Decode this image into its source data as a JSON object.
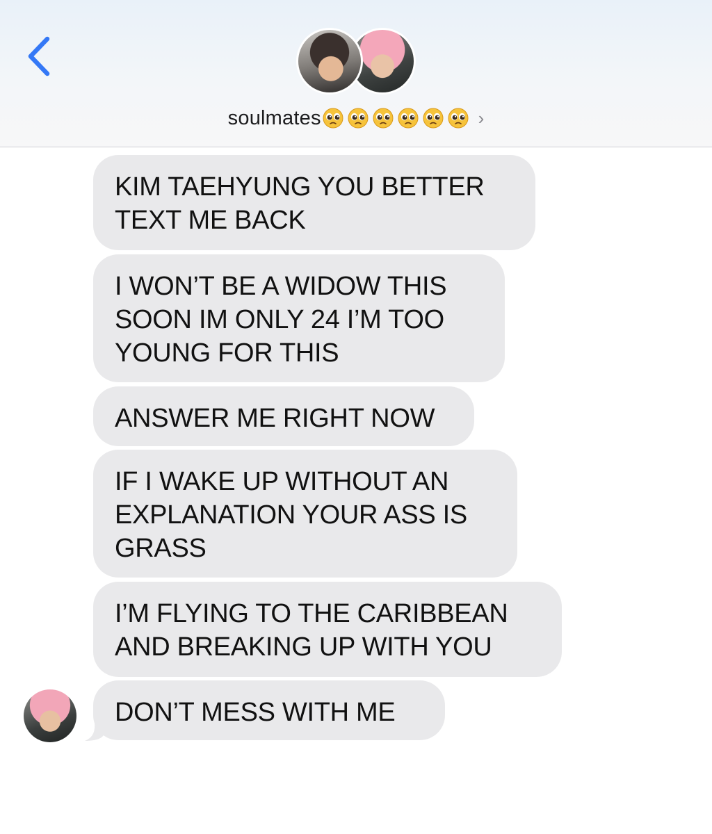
{
  "header": {
    "back_icon": "chevron-left-icon",
    "contact_name": "soulmates",
    "emoji_icon": "pleading-face-emoji",
    "emoji_count": 6,
    "disclosure_icon": "chevron-right-icon",
    "disclosure_glyph": "›",
    "accent_color": "#3478f6"
  },
  "messages": [
    {
      "lines": [
        "KIM TAEHYUNG YOU BETTER",
        "TEXT ME BACK"
      ]
    },
    {
      "lines": [
        "I WON’T BE A WIDOW THIS",
        "SOON IM ONLY 24 I’M TOO",
        "YOUNG FOR THIS"
      ]
    },
    {
      "lines": [
        "ANSWER ME RIGHT NOW"
      ]
    },
    {
      "lines": [
        "IF I WAKE UP WITHOUT AN",
        "EXPLANATION YOUR ASS IS",
        "GRASS"
      ]
    },
    {
      "lines": [
        "I’M FLYING TO THE CARIBBEAN",
        "AND BREAKING UP WITH YOU"
      ]
    },
    {
      "lines": [
        "DON’T MESS WITH ME"
      ]
    }
  ],
  "colors": {
    "bubble_received": "#e9e9eb",
    "text": "#111111"
  }
}
